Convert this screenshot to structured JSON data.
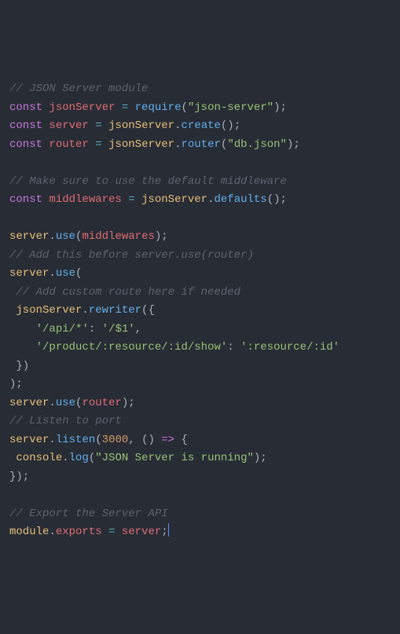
{
  "lines": {
    "c1": "// JSON Server module",
    "l2_kw": "const",
    "l2_var": "jsonServer",
    "l2_fn": "require",
    "l2_str": "\"json-server\"",
    "l3_kw": "const",
    "l3_var": "server",
    "l3_obj": "jsonServer",
    "l3_fn": "create",
    "l4_kw": "const",
    "l4_var": "router",
    "l4_obj": "jsonServer",
    "l4_fn": "router",
    "l4_str": "\"db.json\"",
    "c5": "// Make sure to use the default middleware",
    "l6_kw": "const",
    "l6_var": "middlewares",
    "l6_obj": "jsonServer",
    "l6_fn": "defaults",
    "l7_obj": "server",
    "l7_fn": "use",
    "l7_arg": "middlewares",
    "c8": "// Add this before server.use(router)",
    "l9_obj": "server",
    "l9_fn": "use",
    "c10": "// Add custom route here if needed",
    "l11_obj": "jsonServer",
    "l11_fn": "rewriter",
    "l12_k": "'/api/*'",
    "l12_v": "'/$1'",
    "l13_k": "'/product/:resource/:id/show'",
    "l13_v": "':resource/:id'",
    "l14_obj": "server",
    "l14_fn": "use",
    "l14_arg": "router",
    "c15": "// Listen to port",
    "l16_obj": "server",
    "l16_fn": "listen",
    "l16_num": "3000",
    "l17_obj": "console",
    "l17_fn": "log",
    "l17_str": "\"JSON Server is running\"",
    "c18": "// Export the Server API",
    "l19_obj": "module",
    "l19_prop": "exports",
    "l19_var": "server"
  }
}
